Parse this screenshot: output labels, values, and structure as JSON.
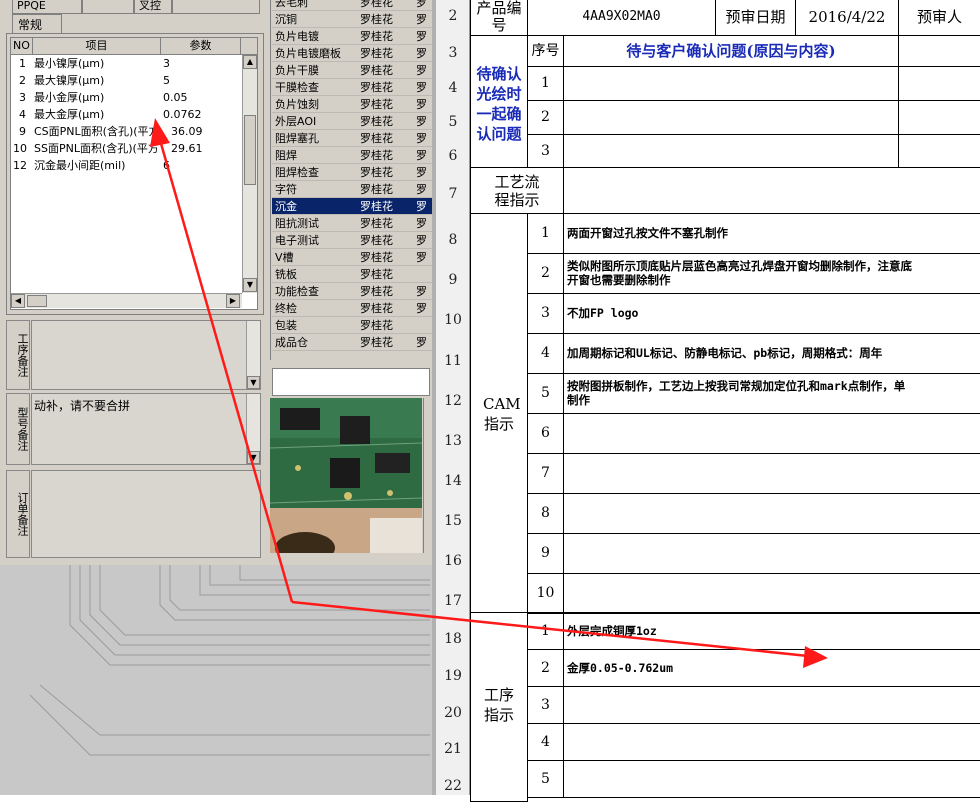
{
  "left_app": {
    "tabs": [
      "PPQE",
      "",
      "叉控",
      ""
    ],
    "subtab": "常规",
    "param_table": {
      "headers": [
        "NO",
        "项目",
        "参数"
      ],
      "rows": [
        {
          "no": "1",
          "item": "最小镍厚(μm)",
          "value": "3"
        },
        {
          "no": "2",
          "item": "最大镍厚(μm)",
          "value": "5"
        },
        {
          "no": "3",
          "item": "最小金厚(μm)",
          "value": "0.05"
        },
        {
          "no": "4",
          "item": "最大金厚(μm)",
          "value": "0.0762"
        },
        {
          "no": "9",
          "item": "CS面PNL面积(含孔)(平方",
          "value": "36.09"
        },
        {
          "no": "10",
          "item": "SS面PNL面积(含孔)(平方",
          "value": "29.61"
        },
        {
          "no": "12",
          "item": "沉金最小间距(mil)",
          "value": "6"
        }
      ]
    },
    "notes": [
      {
        "label": "工序备注",
        "text": ""
      },
      {
        "label": "型号备注",
        "text": "动补，请不要合拼"
      },
      {
        "label": "订单备注",
        "text": ""
      }
    ],
    "process_list": [
      {
        "name": "去毛刺",
        "person": "罗桂花",
        "extra": "罗"
      },
      {
        "name": "沉铜",
        "person": "罗桂花",
        "extra": "罗"
      },
      {
        "name": "负片电镀",
        "person": "罗桂花",
        "extra": "罗"
      },
      {
        "name": "负片电镀磨板",
        "person": "罗桂花",
        "extra": "罗"
      },
      {
        "name": "负片干膜",
        "person": "罗桂花",
        "extra": "罗"
      },
      {
        "name": "干膜检查",
        "person": "罗桂花",
        "extra": "罗"
      },
      {
        "name": "负片蚀刻",
        "person": "罗桂花",
        "extra": "罗"
      },
      {
        "name": "外层AOI",
        "person": "罗桂花",
        "extra": "罗"
      },
      {
        "name": "阻焊塞孔",
        "person": "罗桂花",
        "extra": "罗"
      },
      {
        "name": "阻焊",
        "person": "罗桂花",
        "extra": "罗"
      },
      {
        "name": "阻焊检查",
        "person": "罗桂花",
        "extra": "罗"
      },
      {
        "name": "字符",
        "person": "罗桂花",
        "extra": "罗"
      },
      {
        "name": "沉金",
        "person": "罗桂花",
        "extra": "罗",
        "selected": true
      },
      {
        "name": "阻抗测试",
        "person": "罗桂花",
        "extra": "罗"
      },
      {
        "name": "电子测试",
        "person": "罗桂花",
        "extra": "罗"
      },
      {
        "name": "V槽",
        "person": "罗桂花",
        "extra": "罗"
      },
      {
        "name": "铣板",
        "person": "罗桂花",
        "extra": ""
      },
      {
        "name": "功能检查",
        "person": "罗桂花",
        "extra": "罗"
      },
      {
        "name": "终检",
        "person": "罗桂花",
        "extra": "罗"
      },
      {
        "name": "包装",
        "person": "罗桂花",
        "extra": ""
      },
      {
        "name": "成品仓",
        "person": "罗桂花",
        "extra": "罗"
      }
    ],
    "selected_color": "#0a246a"
  },
  "sheet": {
    "row_numbers": [
      "2",
      "3",
      "4",
      "5",
      "6",
      "7",
      "8",
      "9",
      "10",
      "11",
      "12",
      "13",
      "14",
      "15",
      "16",
      "17",
      "18",
      "19",
      "20",
      "21",
      "22"
    ],
    "product_label": "产品编号",
    "product_code": "4AA9X02ΜA0",
    "review_date_label": "预审日期",
    "review_date": "2016/4/22",
    "reviewer_label": "预审人",
    "seq_label": "序号",
    "pending_title": "待与客户确认问题(原因与内容)",
    "pending_section": "待确认光绘时一起确认问题",
    "pending_nums": [
      "1",
      "2",
      "3"
    ],
    "flow_label": "工艺流程指示",
    "cam_label": "CAM指示",
    "cam_rows": [
      {
        "n": "1",
        "text": "两面开窗过孔按文件不塞孔制作"
      },
      {
        "n": "2",
        "text": "类似附图所示顶底贴片层蓝色高亮过孔焊盘开窗均删除制作，注意底",
        "text2": "开窗也需要删除制作"
      },
      {
        "n": "3",
        "text": "不加FP logo"
      },
      {
        "n": "4",
        "text": "加周期标记和UL标记、防静电标记、pb标记，周期格式：周年"
      },
      {
        "n": "5",
        "text": "按附图拼板制作，工艺边上按我司常规加定位孔和mark点制作，单",
        "text2": "制作"
      },
      {
        "n": "6",
        "text": ""
      },
      {
        "n": "7",
        "text": ""
      },
      {
        "n": "8",
        "text": ""
      },
      {
        "n": "9",
        "text": ""
      },
      {
        "n": "10",
        "text": ""
      }
    ],
    "proc_label": "工序指示",
    "proc_rows": [
      {
        "n": "1",
        "text": "外层完成铜厚1oz"
      },
      {
        "n": "2",
        "text": "金厚0.05-0.762um"
      },
      {
        "n": "3",
        "text": ""
      },
      {
        "n": "4",
        "text": ""
      },
      {
        "n": "5",
        "text": ""
      }
    ]
  },
  "colors": {
    "arrow": "#ff1a1a",
    "blue_text": "#1a2bb8",
    "panel": "#d4d0c8"
  }
}
